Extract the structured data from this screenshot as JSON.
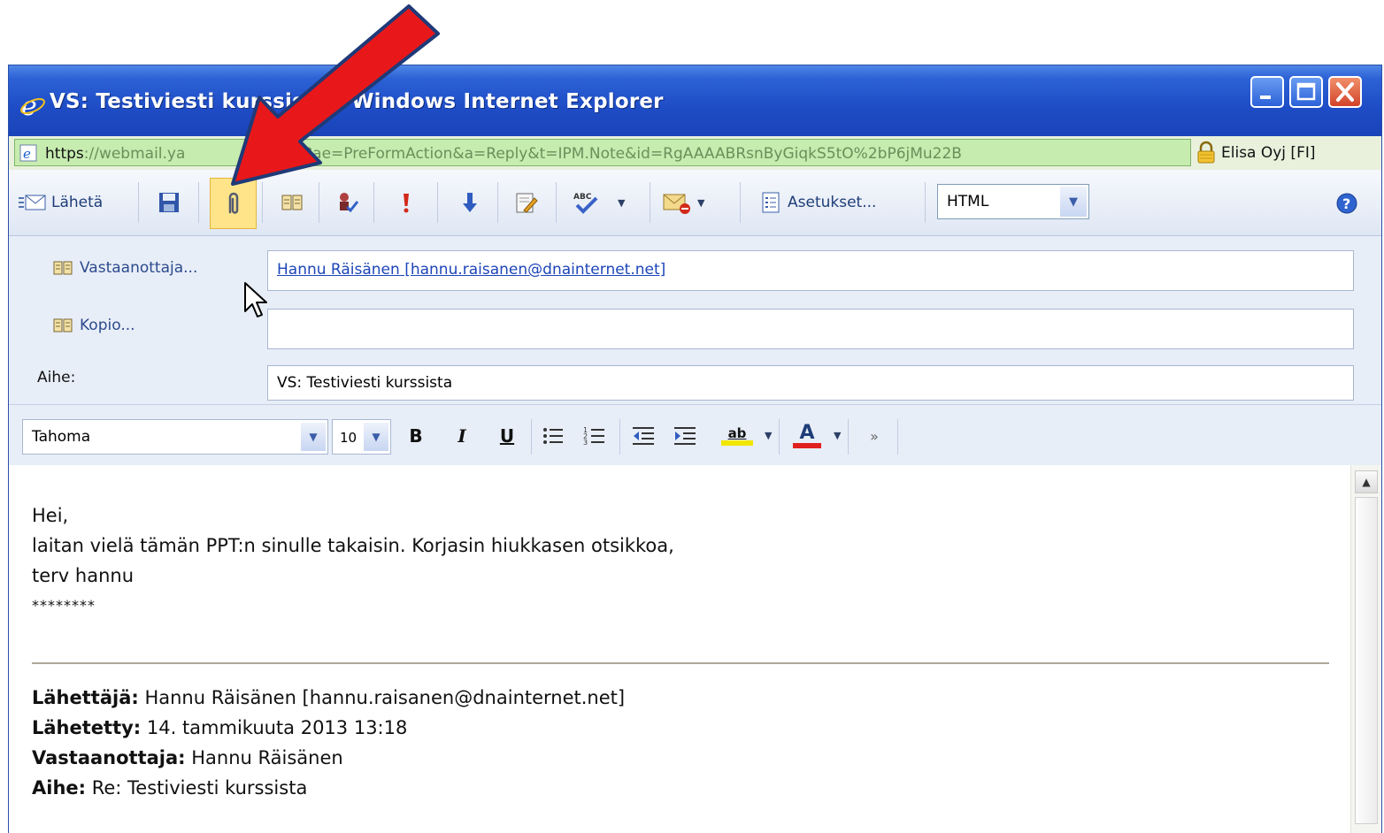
{
  "window": {
    "title": "VS: Testiviesti kurssista - Windows Internet Explorer"
  },
  "address_bar": {
    "url_scheme": "https",
    "url_prefix": "://webmail.ya",
    "url_host_tail": "a.fi",
    "url_path": "/owa/?ae=PreFormAction&a=Reply&t=IPM.Note&id=RgAAAABRsnByGiqkS5tO%2bP6jMu22B",
    "certificate": "Elisa Oyj [FI]"
  },
  "toolbar": {
    "send_label": "Lähetä",
    "options_label": "Asetukset...",
    "format_value": "HTML",
    "icons": [
      "send-icon",
      "save-icon",
      "attach-icon",
      "address-book-icon",
      "check-names-icon",
      "importance-high-icon",
      "importance-low-icon",
      "signature-icon",
      "spellcheck-icon",
      "message-options-icon",
      "options-icon",
      "help-icon"
    ]
  },
  "fields": {
    "to_label": "Vastaanottaja...",
    "to_value": "Hannu Räisänen [hannu.raisanen@dnainternet.net]",
    "cc_label": "Kopio...",
    "cc_value": "",
    "subject_label": "Aihe:",
    "subject_value": "VS: Testiviesti kurssista"
  },
  "formatting": {
    "font": "Tahoma",
    "size": "10",
    "bold": "B",
    "italic": "I",
    "underline": "U",
    "highlight_text": "ab",
    "font_color_text": "A",
    "highlight_color": "#f2e600",
    "font_color": "#e02020"
  },
  "body": {
    "line1": "Hei,",
    "line2": "laitan vielä tämän PPT:n sinulle takaisin. Korjasin hiukkasen otsikkoa,",
    "line3": "terv hannu",
    "line4": "********",
    "from_label": "Lähettäjä:",
    "from_value": " Hannu Räisänen [hannu.raisanen@dnainternet.net]",
    "sent_label": "Lähetetty:",
    "sent_value": " 14. tammikuuta 2013 13:18",
    "to_label": "Vastaanottaja:",
    "to_value": " Hannu Räisänen",
    "subject_label": "Aihe:",
    "subject_value": " Re: Testiviesti kurssista"
  },
  "annotation": {
    "arrow_color": "#e8181a",
    "arrow_outline": "#1f3a78"
  }
}
